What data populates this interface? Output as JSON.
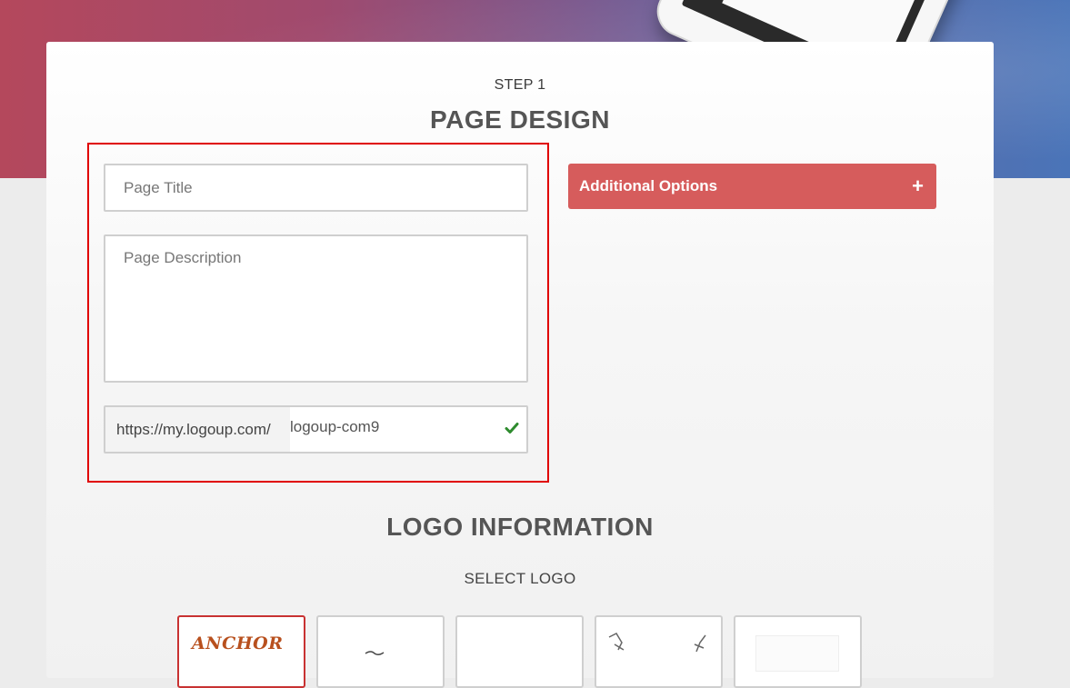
{
  "step": {
    "label": "STEP 1"
  },
  "page_design": {
    "title": "PAGE DESIGN",
    "page_title_placeholder": "Page Title",
    "page_description_placeholder": "Page Description",
    "url_prefix": "https://my.logoup.com/",
    "url_slug": "logoup-com9",
    "url_status_icon": "check-icon"
  },
  "additional_options": {
    "label": "Additional Options",
    "icon": "plus-icon"
  },
  "logo_info": {
    "title": "LOGO INFORMATION",
    "select_label": "SELECT LOGO",
    "logos": [
      {
        "text": "ANCHOR",
        "selected": true
      },
      {
        "text": "",
        "selected": false
      },
      {
        "text": "",
        "selected": false
      },
      {
        "text": "",
        "selected": false
      },
      {
        "text": "",
        "selected": false
      }
    ]
  },
  "colors": {
    "accent": "#d65c5c",
    "highlight_border": "#e00000",
    "success": "#2e8b2e",
    "heading": "#555555"
  }
}
